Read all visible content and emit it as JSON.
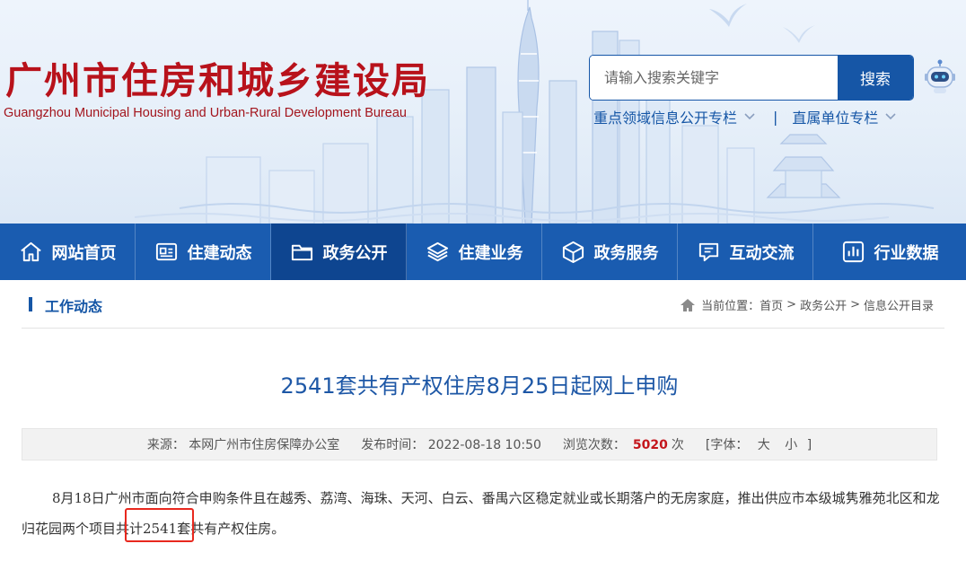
{
  "header": {
    "title": "广州市住房和城乡建设局",
    "subtitle": "Guangzhou Municipal Housing and Urban-Rural Development Bureau",
    "search": {
      "placeholder": "请输入搜索关键字",
      "button_label": "搜索"
    },
    "quick_links": [
      {
        "label": "重点领域信息公开专栏"
      },
      {
        "label": "直属单位专栏"
      }
    ],
    "separator": "|"
  },
  "nav": {
    "items": [
      {
        "label": "网站首页",
        "icon": "home-icon"
      },
      {
        "label": "住建动态",
        "icon": "news-icon"
      },
      {
        "label": "政务公开",
        "icon": "folder-icon",
        "active": true
      },
      {
        "label": "住建业务",
        "icon": "layers-icon"
      },
      {
        "label": "政务服务",
        "icon": "box-icon"
      },
      {
        "label": "互动交流",
        "icon": "chat-icon"
      },
      {
        "label": "行业数据",
        "icon": "chart-icon"
      }
    ]
  },
  "section": {
    "title": "工作动态",
    "breadcrumb": {
      "prefix": "当前位置：",
      "items": [
        "首页",
        "政务公开",
        "信息公开目录"
      ],
      "separator": ">"
    }
  },
  "article": {
    "title": "2541套共有产权住房8月25日起网上申购",
    "meta": {
      "source_label": "来源：",
      "source": "本网广州市住房保障办公室",
      "date_label": "发布时间：",
      "date": "2022-08-18 10:50",
      "views_label": "浏览次数：",
      "views": "5020",
      "views_unit": "次",
      "font_open": "[字体：",
      "font_large": "大",
      "font_small": "小",
      "font_close": "]"
    },
    "body_before": "8月18日广州市面向符合申购条件且在越秀、荔湾、海珠、天河、白云、番禺六区稳定就业或长期落户的无房家庭，推出供应市本级城隽雅苑北区和",
    "body_highlight": "龙归花园",
    "body_after": "两个项目共计2541套共有产权住房。"
  },
  "colors": {
    "brand_red": "#b8121b",
    "nav_blue": "#1a5cb0",
    "nav_active": "#0e4590",
    "link_blue": "#1556a6",
    "highlight_box": "#e8281e"
  }
}
